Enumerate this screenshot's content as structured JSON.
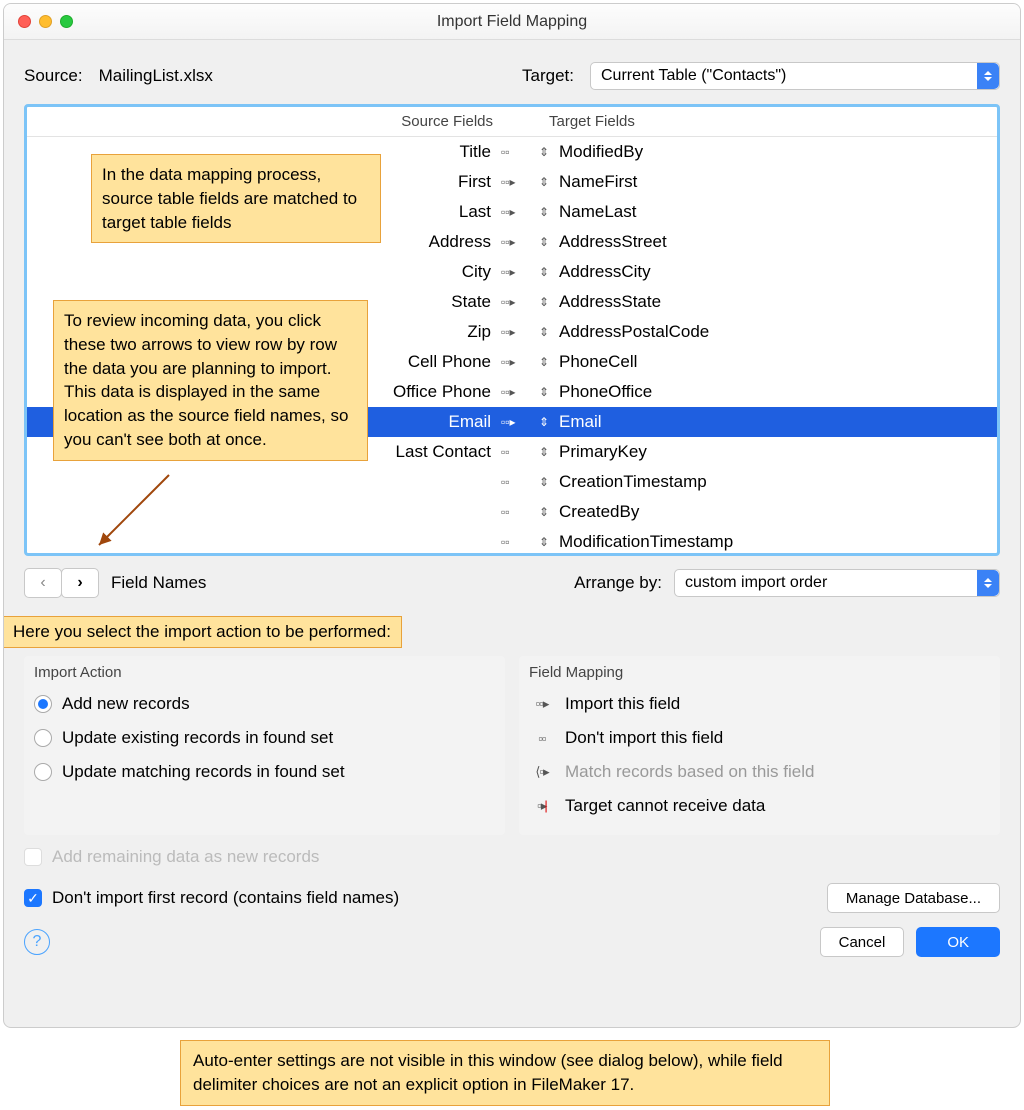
{
  "window": {
    "title": "Import Field Mapping"
  },
  "source": {
    "label": "Source:",
    "value": "MailingList.xlsx"
  },
  "target": {
    "label": "Target:",
    "value": "Current Table (\"Contacts\")"
  },
  "columns": {
    "source": "Source Fields",
    "target": "Target Fields"
  },
  "rows": [
    {
      "src": "Title",
      "arrow": "no",
      "tgt": "ModifiedBy"
    },
    {
      "src": "First",
      "arrow": "yes",
      "tgt": "NameFirst"
    },
    {
      "src": "Last",
      "arrow": "yes",
      "tgt": "NameLast"
    },
    {
      "src": "Address",
      "arrow": "yes",
      "tgt": "AddressStreet"
    },
    {
      "src": "City",
      "arrow": "yes",
      "tgt": "AddressCity"
    },
    {
      "src": "State",
      "arrow": "yes",
      "tgt": "AddressState"
    },
    {
      "src": "Zip",
      "arrow": "yes",
      "tgt": "AddressPostalCode"
    },
    {
      "src": "Cell Phone",
      "arrow": "yes",
      "tgt": "PhoneCell"
    },
    {
      "src": "Office Phone",
      "arrow": "yes",
      "tgt": "PhoneOffice"
    },
    {
      "src": "Email",
      "arrow": "sel",
      "tgt": "Email",
      "selected": true
    },
    {
      "src": "Last Contact",
      "arrow": "no",
      "tgt": "PrimaryKey"
    },
    {
      "src": "",
      "arrow": "no",
      "tgt": "CreationTimestamp"
    },
    {
      "src": "",
      "arrow": "no",
      "tgt": "CreatedBy"
    },
    {
      "src": "",
      "arrow": "no",
      "tgt": "ModificationTimestamp"
    }
  ],
  "callouts": {
    "c1": "In the data mapping process, source table fields are matched to target table fields",
    "c2": "To review incoming data, you click these two arrows to view row by row the data you are planning to import. This data is displayed in the same location as the source field names, so you can't see both at once.",
    "c3": "Here you select the import action to be performed:",
    "footer": "Auto-enter settings are not visible in this window (see dialog below), while field delimiter choices are not an explicit option in FileMaker 17."
  },
  "nav": {
    "field_names": "Field Names",
    "arrange_label": "Arrange by:",
    "arrange_value": "custom import order"
  },
  "import_action": {
    "title": "Import Action",
    "opts": [
      "Add new records",
      "Update existing records in found set",
      "Update matching records in found set"
    ]
  },
  "field_mapping": {
    "title": "Field Mapping",
    "legend": [
      {
        "icon": "yes",
        "label": "Import this field"
      },
      {
        "icon": "no",
        "label": "Don't import this field"
      },
      {
        "icon": "match",
        "label": "Match records based on this field",
        "disabled": true
      },
      {
        "icon": "block",
        "label": "Target cannot receive data"
      }
    ]
  },
  "checks": {
    "add_remaining": "Add remaining data as new records",
    "skip_first": "Don't import first record (contains field names)"
  },
  "buttons": {
    "manage_db": "Manage Database...",
    "cancel": "Cancel",
    "ok": "OK"
  }
}
